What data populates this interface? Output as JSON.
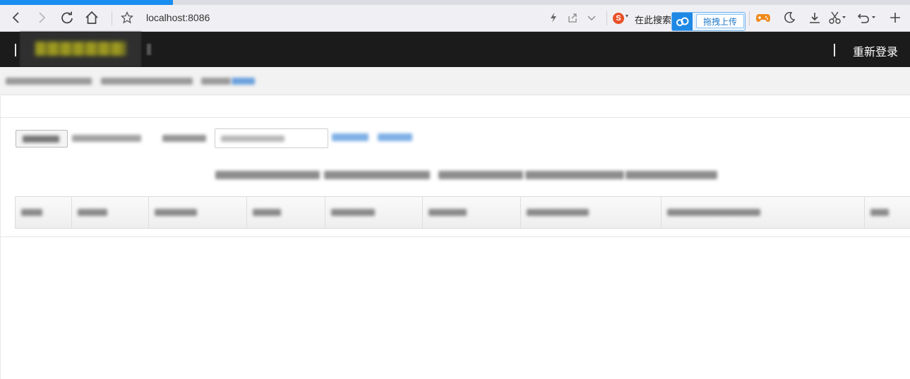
{
  "browser": {
    "address": "localhost:8086",
    "search_label": "在此搜索",
    "sogou_icon_letter": "S",
    "upload_label": "拖拽上传",
    "loading_progress": 0.19,
    "icons": [
      "back-icon",
      "forward-icon",
      "refresh-icon",
      "home-icon",
      "star-icon",
      "lightning-icon",
      "share-icon",
      "chevron-down-icon",
      "sogou-icon",
      "magnifier-icon",
      "gamepad-icon",
      "moon-icon",
      "download-icon",
      "scissors-icon",
      "undo-icon",
      "plus-icon",
      "cloud-icon"
    ]
  },
  "header": {
    "relogin_label": "重新登录"
  },
  "colors": {
    "header_bg": "#1b1b1b",
    "accent_blue": "#1a8df0",
    "breadcrumb_bg": "#f2f2f2"
  }
}
